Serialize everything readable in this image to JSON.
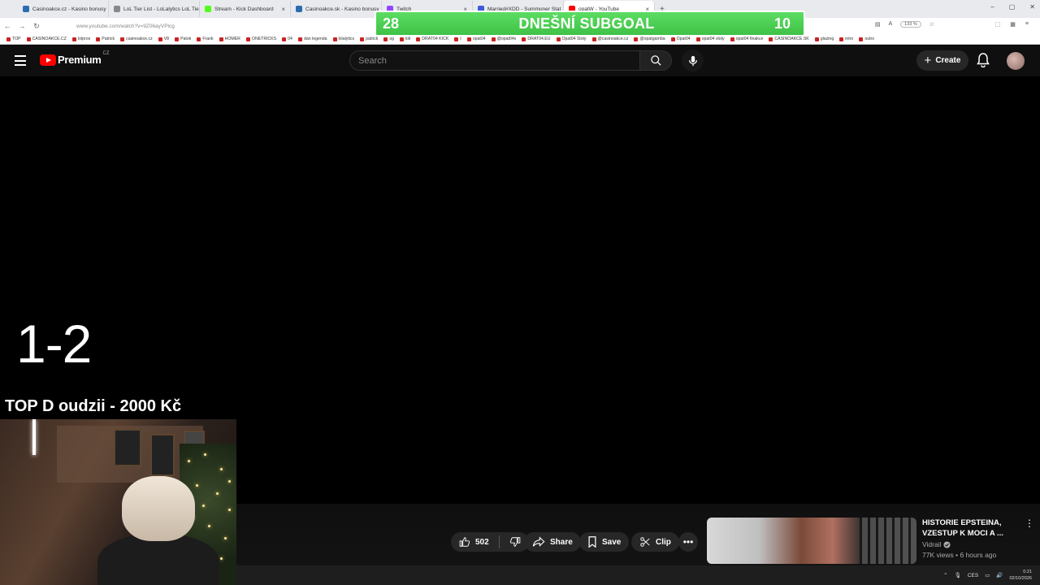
{
  "browser": {
    "tabs": [
      {
        "label": "Casinoakce.cz - Kasino bonusy",
        "color": "#2b6cb0"
      },
      {
        "label": "LoL Tier List - LoLalytics LoL Tie",
        "color": "#888888"
      },
      {
        "label": "Stream - Kick Dashboard",
        "color": "#53fc18"
      },
      {
        "label": "Casinoakce.sk - Kasino bonusy",
        "color": "#2b6cb0"
      },
      {
        "label": "Twitch",
        "color": "#9146ff"
      },
      {
        "label": "Married#XDD - Summoner Stat",
        "color": "#3b5bdb"
      },
      {
        "label": "opatW - YouTube",
        "color": "#ff0000"
      }
    ],
    "url": "www.youtube.com/watch?v=9Z06ayVPlcg",
    "zoom": "133 %",
    "bookmarks": [
      "TOP",
      "CASINOAKCE.CZ",
      "lolpros",
      "Patrick",
      "casinoakce.cz",
      "V8",
      "Patok",
      "Frank",
      "HOMER",
      "ONETRICKS",
      "04",
      "dan legenda",
      "lolalytics",
      "patrick",
      "sg",
      "loli",
      "DRAT04 KICK",
      "t",
      "opat04",
      "@opat04x",
      "DRAT04.EU",
      "Opat04 Sloty",
      "@casinoakce.cz",
      "@opatgamba",
      "Opat04",
      "opat04 sloty",
      "opat04 finakce",
      "CASINOAKCE.SK",
      "glazing",
      "intro",
      "outro"
    ]
  },
  "subgoal": {
    "left_value": "28",
    "title": "DNEŠNÍ SUBGOAL",
    "right_value": "10"
  },
  "youtube": {
    "logo_text": "Premium",
    "country": "CZ",
    "search_placeholder": "Search",
    "create_label": "Create"
  },
  "overlay": {
    "score": "1-2",
    "top_text": "TOP D  oudzii - 2000 Kč"
  },
  "actions": {
    "like_count": "502",
    "share_label": "Share",
    "save_label": "Save",
    "clip_label": "Clip"
  },
  "recommended": {
    "title": "HISTORIE EPSTEINA, VZESTUP K MOCI A ...",
    "channel": "Vidrail",
    "meta": "77K views • 6 hours ago"
  },
  "taskbar": {
    "lang": "CES",
    "time": "0:21",
    "date": "02/10/2026"
  }
}
